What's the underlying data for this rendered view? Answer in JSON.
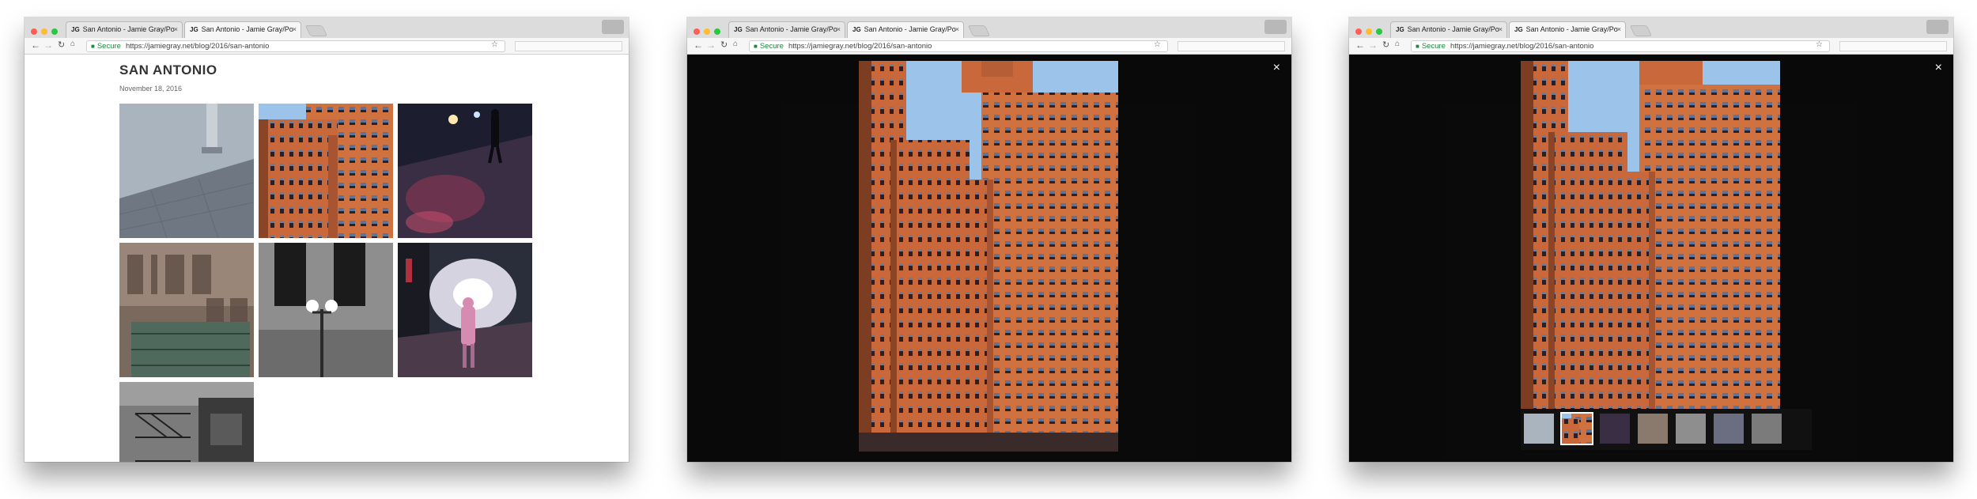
{
  "browser": {
    "tabs": [
      {
        "favicon": "JG",
        "title": "San Antonio - Jamie Gray/Po",
        "close": "×"
      },
      {
        "favicon": "JG",
        "title": "San Antonio - Jamie Gray/Po",
        "close": "×"
      }
    ],
    "secure_label": "Secure",
    "url": "https://jamiegray.net/blog/2016/san-antonio"
  },
  "page": {
    "title": "SAN ANTONIO",
    "date": "November 18, 2016"
  },
  "icons": {
    "back": "back-arrow-icon",
    "forward": "forward-arrow-icon",
    "reload": "reload-icon",
    "home": "home-icon",
    "lock": "lock-icon",
    "star": "bookmark-star-icon",
    "close": "close-icon"
  },
  "lightbox": {
    "close_glyph": "×"
  },
  "colors": {
    "overlay": "#0a0a0a",
    "brick": "#c8673a",
    "sky": "#9cc3ea",
    "secure_green": "#1a8a3a"
  }
}
